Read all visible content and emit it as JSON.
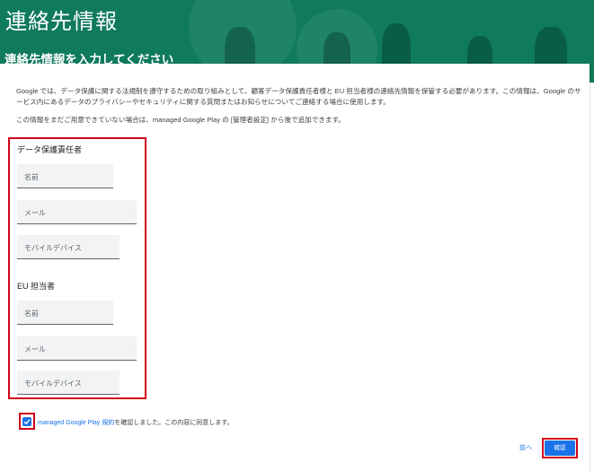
{
  "header": {
    "title": "連絡先情報",
    "subtitle": "連絡先情報を入力してください"
  },
  "intro": {
    "paragraph": "Google では、データ保護に関する法規制を遵守するための取り組みとして、顧客データ保護責任者様と EU 担当者様の連絡先情報を保管する必要があります。この情報は、Google のサービス内にあるデータのプライバシーやセキュリティに関する質問またはお知らせについてご連絡する場合に使用します。",
    "note": "この情報をまだご用意できていない場合は、managed Google Play の [管理者設定] から後で追加できます。"
  },
  "dpo": {
    "label": "データ保護責任者",
    "name_placeholder": "名前",
    "email_placeholder": "メール",
    "phone_placeholder": "モバイルデバイス"
  },
  "eu": {
    "label": "EU 担当者",
    "name_placeholder": "名前",
    "email_placeholder": "メール",
    "phone_placeholder": "モバイルデバイス"
  },
  "agreement": {
    "checked": true,
    "link_text": "managed Google Play 規約",
    "text": "を確認しました。この内容に同意します。"
  },
  "actions": {
    "back_label": "前へ",
    "confirm_label": "確認"
  },
  "colors": {
    "header_bg": "#0f7a5c",
    "accent": "#1a73e8",
    "highlight": "#d0021b"
  }
}
